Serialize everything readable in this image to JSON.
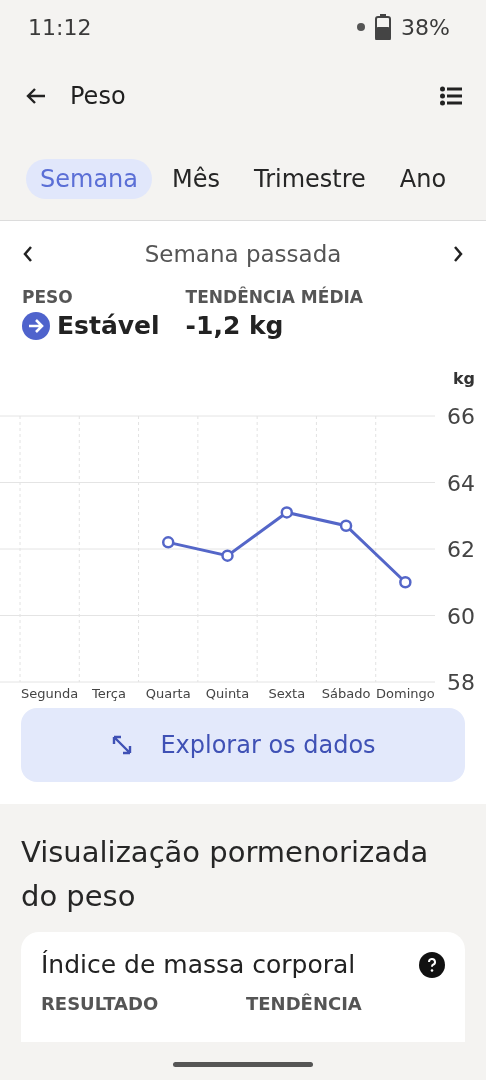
{
  "status_bar": {
    "time": "11:12",
    "battery": "38%"
  },
  "app_bar": {
    "title": "Peso"
  },
  "tabs": [
    {
      "label": "Semana",
      "selected": true
    },
    {
      "label": "Mês",
      "selected": false
    },
    {
      "label": "Trimestre",
      "selected": false
    },
    {
      "label": "Ano",
      "selected": false
    }
  ],
  "period": {
    "label": "Semana passada"
  },
  "stats": [
    {
      "label": "PESO",
      "value": "Estável",
      "kind": "status"
    },
    {
      "label": "TENDÊNCIA MÉDIA",
      "value": "-1,2 kg",
      "kind": "plain"
    }
  ],
  "chart": {
    "chart_data": {
      "type": "line",
      "ylabel": "kg",
      "categories": [
        "Segunda",
        "Terça",
        "Quarta",
        "Quinta",
        "Sexta",
        "Sábado",
        "Domingo"
      ],
      "series": [
        {
          "color": "#5466c8",
          "marker": true,
          "values": [
            null,
            null,
            62.2,
            61.8,
            63.1,
            62.7,
            61.0
          ]
        }
      ],
      "grid": true,
      "ylim": [
        58,
        66
      ],
      "yticks": [
        58,
        60,
        62,
        64,
        66
      ]
    }
  },
  "explore_button": {
    "label": "Explorar os dados"
  },
  "section": {
    "title": "Visualização pormenorizada do peso"
  },
  "bmi_card": {
    "title": "Índice de massa corporal",
    "labels": [
      "RESULTADO",
      "TENDÊNCIA"
    ]
  }
}
